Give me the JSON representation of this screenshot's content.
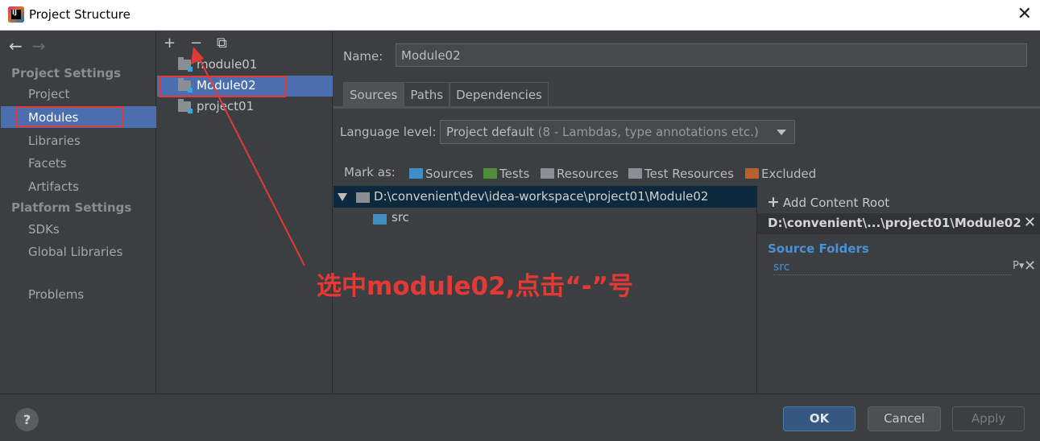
{
  "window": {
    "title": "Project Structure",
    "close_glyph": "✕"
  },
  "nav": {
    "back_glyph": "←",
    "forward_glyph": "→",
    "project_settings_heading": "Project Settings",
    "project_settings": [
      "Project",
      "Modules",
      "Libraries",
      "Facets",
      "Artifacts"
    ],
    "platform_settings_heading": "Platform Settings",
    "platform_settings": [
      "SDKs",
      "Global Libraries"
    ],
    "problems": "Problems",
    "selected": "Modules"
  },
  "module_tree": {
    "add_glyph": "+",
    "remove_glyph": "−",
    "copy_glyph": "⧉",
    "items": [
      "module01",
      "Module02",
      "project01"
    ],
    "selected": "Module02"
  },
  "module_details": {
    "name_label": "Name:",
    "name_value": "Module02",
    "tabs": [
      "Sources",
      "Paths",
      "Dependencies"
    ],
    "active_tab": "Sources",
    "language_level_label": "Language level:",
    "language_level_value": "Project default",
    "language_level_hint": "(8 - Lambdas, type annotations etc.)",
    "mark_as_label": "Mark as:",
    "mark_as": [
      {
        "label": "Sources",
        "color": "#3f8ec4"
      },
      {
        "label": "Tests",
        "color": "#4f8c3c"
      },
      {
        "label": "Resources",
        "color": "#8a8f93"
      },
      {
        "label": "Test Resources",
        "color": "#8a8f93"
      },
      {
        "label": "Excluded",
        "color": "#b8602e"
      }
    ],
    "content_root_path": "D:\\convenient\\dev\\idea-workspace\\project01\\Module02",
    "content_child": "src",
    "add_content_root": "Add Content Root",
    "add_glyph": "+",
    "short_path": "D:\\convenient\\...\\project01\\Module02",
    "remove_glyph": "✕",
    "source_folders_heading": "Source Folders",
    "source_folder": "src",
    "source_folder_prop_glyph": "P▾"
  },
  "footer": {
    "help": "?",
    "ok": "OK",
    "cancel": "Cancel",
    "apply": "Apply"
  },
  "annotation": {
    "text": "选中module02,点击“-”号",
    "color": "#e53935"
  }
}
